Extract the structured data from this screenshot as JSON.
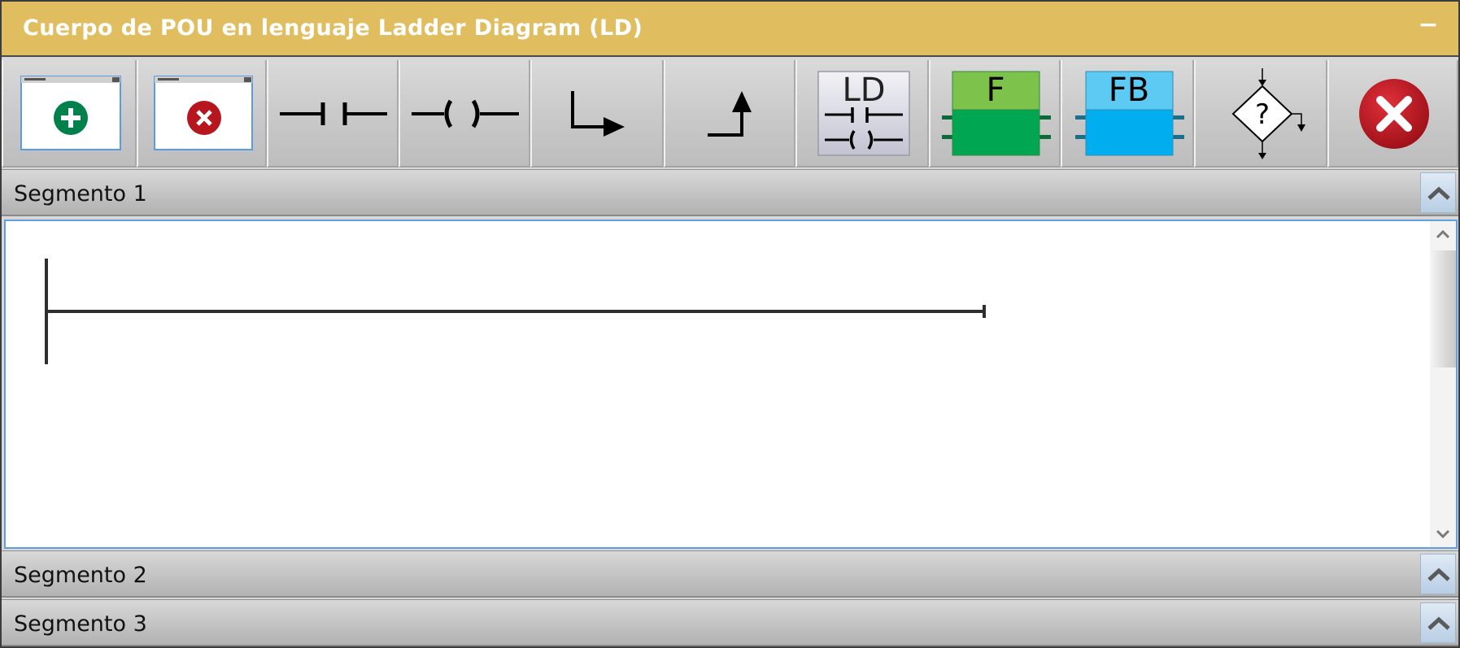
{
  "window": {
    "title": "Cuerpo de POU en lenguaje Ladder Diagram (LD)",
    "minimize_glyph": "−",
    "title_bar_color": "#e0bd5f"
  },
  "toolbar": {
    "buttons": [
      {
        "name": "add-segment-button",
        "icon": "window-plus-icon"
      },
      {
        "name": "delete-segment-button",
        "icon": "window-close-icon"
      },
      {
        "name": "contact-button",
        "icon": "ld-contact-icon"
      },
      {
        "name": "coil-button",
        "icon": "ld-coil-icon"
      },
      {
        "name": "branch-down-button",
        "icon": "branch-down-arrow-icon"
      },
      {
        "name": "branch-up-button",
        "icon": "branch-up-arrow-icon"
      },
      {
        "name": "ld-block-button",
        "icon": "ld-block-icon",
        "label": "LD"
      },
      {
        "name": "function-button",
        "icon": "function-block-icon",
        "label": "F"
      },
      {
        "name": "function-block-button",
        "icon": "fb-block-icon",
        "label": "FB"
      },
      {
        "name": "condition-button",
        "icon": "decision-diamond-icon",
        "label": "?"
      },
      {
        "name": "close-editor-button",
        "icon": "close-circle-icon"
      }
    ],
    "colors": {
      "green": "#00a651",
      "green_light": "#7dc24b",
      "blue": "#00adef",
      "blue_light": "#5ccaf2",
      "red": "#c41a26",
      "teal_pin": "#1a6f8a",
      "green_pin": "#0b6b3a"
    }
  },
  "segments": [
    {
      "label": "Segmento 1",
      "expanded": true
    },
    {
      "label": "Segmento 2",
      "expanded": false
    },
    {
      "label": "Segmento 3",
      "expanded": false
    }
  ]
}
